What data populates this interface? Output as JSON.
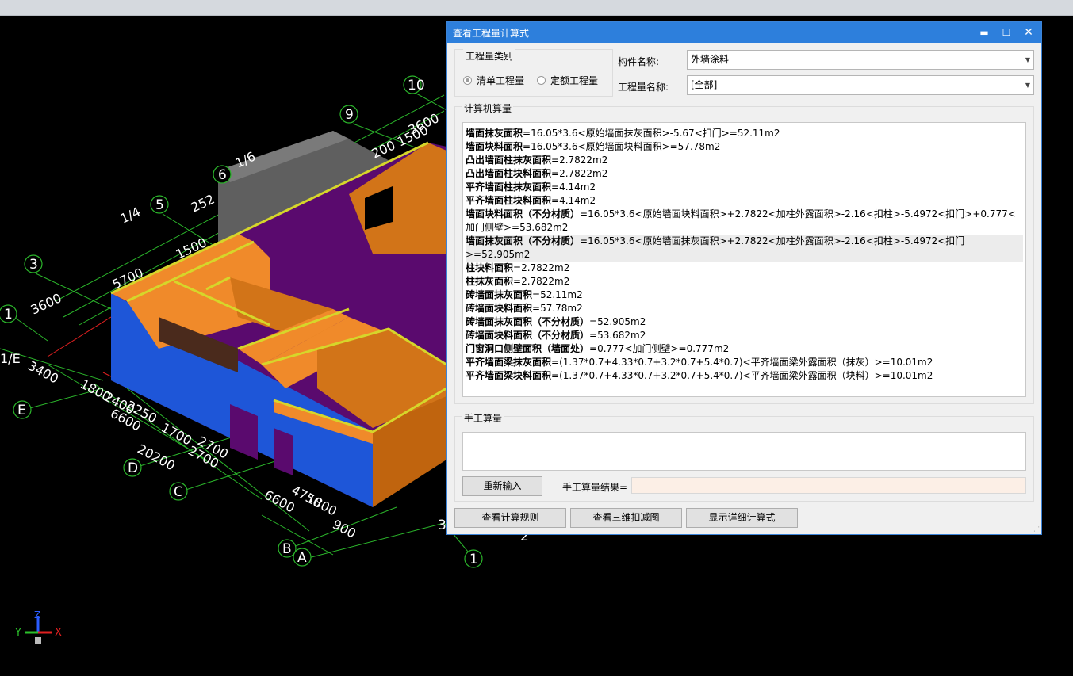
{
  "dialog": {
    "title": "查看工程量计算式",
    "minimize_glyph": "▬",
    "maximize_glyph": "☐",
    "close_glyph": "✕",
    "quantity_type_group": "工程量类别",
    "radio_list_label": "清单工程量",
    "radio_quota_label": "定额工程量",
    "radio_list_selected": true,
    "component_name_label": "构件名称:",
    "component_name_value": "外墙涂料",
    "quantity_name_label": "工程量名称:",
    "quantity_name_value": "[全部]",
    "computer_calc_title": "计算机算量",
    "calc_lines": [
      {
        "name": "墙面抹灰面积",
        "formula": "=16.05*3.6<原始墙面抹灰面积>-5.67<扣门>=52.11m2"
      },
      {
        "name": "墙面块料面积",
        "formula": "=16.05*3.6<原始墙面块料面积>=57.78m2"
      },
      {
        "name": "凸出墙面柱抹灰面积",
        "formula": "=2.7822m2"
      },
      {
        "name": "凸出墙面柱块料面积",
        "formula": "=2.7822m2"
      },
      {
        "name": "平齐墙面柱抹灰面积",
        "formula": "=4.14m2"
      },
      {
        "name": "平齐墙面柱块料面积",
        "formula": "=4.14m2"
      },
      {
        "name": "墙面块料面积（不分材质）",
        "formula": "=16.05*3.6<原始墙面块料面积>+2.7822<加柱外露面积>-2.16<扣柱>-5.4972<扣门>+0.777<加门侧壁>=53.682m2"
      },
      {
        "name": "墙面抹灰面积（不分材质）",
        "formula": "=16.05*3.6<原始墙面抹灰面积>+2.7822<加柱外露面积>-2.16<扣柱>-5.4972<扣门>=52.905m2",
        "highlight": true
      },
      {
        "name": "柱块料面积",
        "formula": "=2.7822m2"
      },
      {
        "name": "柱抹灰面积",
        "formula": "=2.7822m2"
      },
      {
        "name": "砖墙面抹灰面积",
        "formula": "=52.11m2"
      },
      {
        "name": "砖墙面块料面积",
        "formula": "=57.78m2"
      },
      {
        "name": "砖墙面抹灰面积（不分材质）",
        "formula": "=52.905m2"
      },
      {
        "name": "砖墙面块料面积（不分材质）",
        "formula": "=53.682m2"
      },
      {
        "name": "门窗洞口侧壁面积（墙面处）",
        "formula": "=0.777<加门侧壁>=0.777m2"
      },
      {
        "name": "平齐墙面梁抹灰面积",
        "formula": "=(1.37*0.7+4.33*0.7+3.2*0.7+5.4*0.7)<平齐墙面梁外露面积（抹灰）>=10.01m2"
      },
      {
        "name": "平齐墙面梁块料面积",
        "formula": "=(1.37*0.7+4.33*0.7+3.2*0.7+5.4*0.7)<平齐墙面梁外露面积（块料）>=10.01m2"
      }
    ],
    "manual_calc_title": "手工算量",
    "manual_input_value": "",
    "reenter_button": "重新输入",
    "manual_result_label": "手工算量结果=",
    "manual_result_value": "",
    "view_rules_button": "查看计算规则",
    "view_3d_button": "查看三维扣减图",
    "show_detail_button": "显示详细计算式"
  },
  "viewport": {
    "axis_x": "X",
    "axis_y": "Y",
    "axis_z": "Z",
    "grid_circles": [
      "10",
      "9",
      "6",
      "5",
      "3",
      "1",
      "E",
      "D",
      "C",
      "B",
      "A",
      "1",
      "2",
      "3"
    ],
    "dims": [
      "3600",
      "200 1500",
      "1/6",
      "252",
      "1/4",
      "1500",
      "5700",
      "3600",
      "1/E",
      "3400",
      "1800",
      "2400",
      "2250",
      "1700",
      "6600",
      "2700",
      "2700",
      "20200",
      "6600",
      "4750",
      "1800",
      "900"
    ],
    "colors": {
      "grid_line": "#2bb52b",
      "dim_line": "#e02020",
      "wall_outer": "#1e56d8",
      "wall_top": "#f08a2a",
      "floor": "#5a0a6e",
      "roof_block": "#5f5f5f"
    }
  }
}
